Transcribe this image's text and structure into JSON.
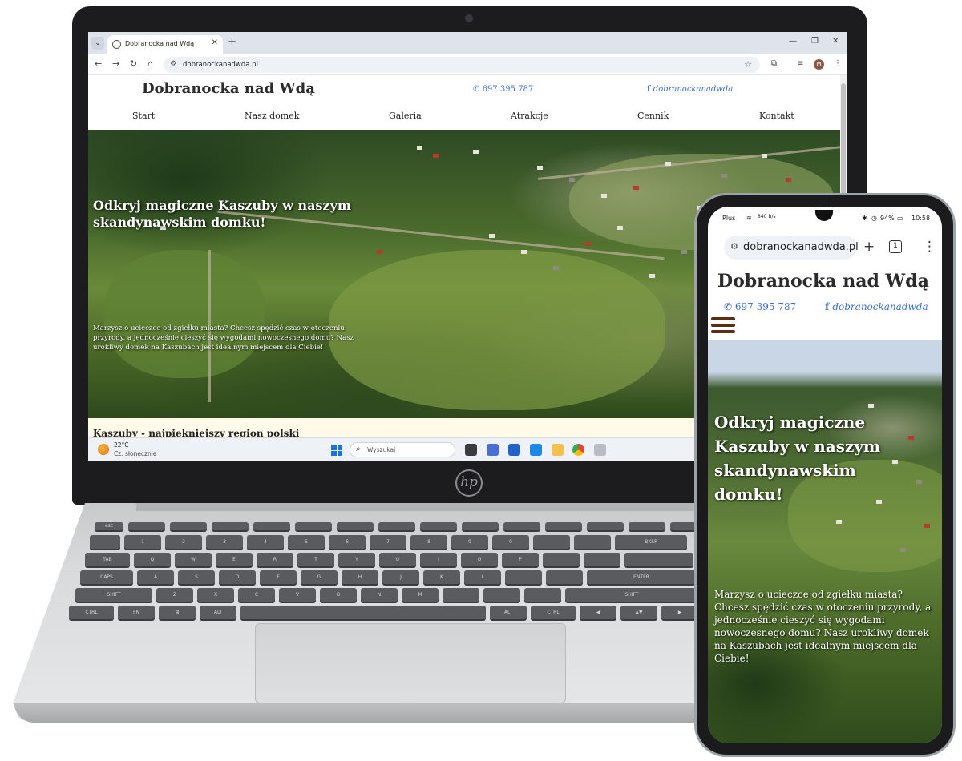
{
  "browser": {
    "tab_title": "Dobranocka nad Wdą",
    "url": "dobranockanadwda.pl",
    "profile_initial": "M"
  },
  "site": {
    "title": "Dobranocka nad Wdą",
    "phone": "697 395 787",
    "facebook": "dobranockanadwda",
    "nav": [
      "Start",
      "Nasz domek",
      "Galeria",
      "Atrakcje",
      "Cennik",
      "Kontakt"
    ],
    "hero_heading": "Odkryj magiczne Kaszuby w naszym skandynawskim domku!",
    "hero_text": "Marzysz o ucieczce od zgiełku miasta? Chcesz spędzić czas w otoczeniu przyrody, a jednocześnie cieszyć się wygodami nowoczesnego domu? Nasz urokliwy domek na Kaszubach jest idealnym miejscem dla Ciebie!",
    "section_title": "Kaszuby - najpiękniejszy region polski"
  },
  "taskbar": {
    "temperature": "22°C",
    "weather": "Cz. słonecznie",
    "search_placeholder": "Wyszukaj"
  },
  "laptop_brand": "hp",
  "phone": {
    "status_carrier": "Plus",
    "status_speed": "840 B/s",
    "status_battery": "94%",
    "status_time": "10:58",
    "url": "dobranockanadwda.pl",
    "tab_count": "1"
  },
  "colors": {
    "link_blue": "#3b6fd8",
    "hamburger_brown": "#5a2e14",
    "section_bg": "#fffbe8"
  }
}
